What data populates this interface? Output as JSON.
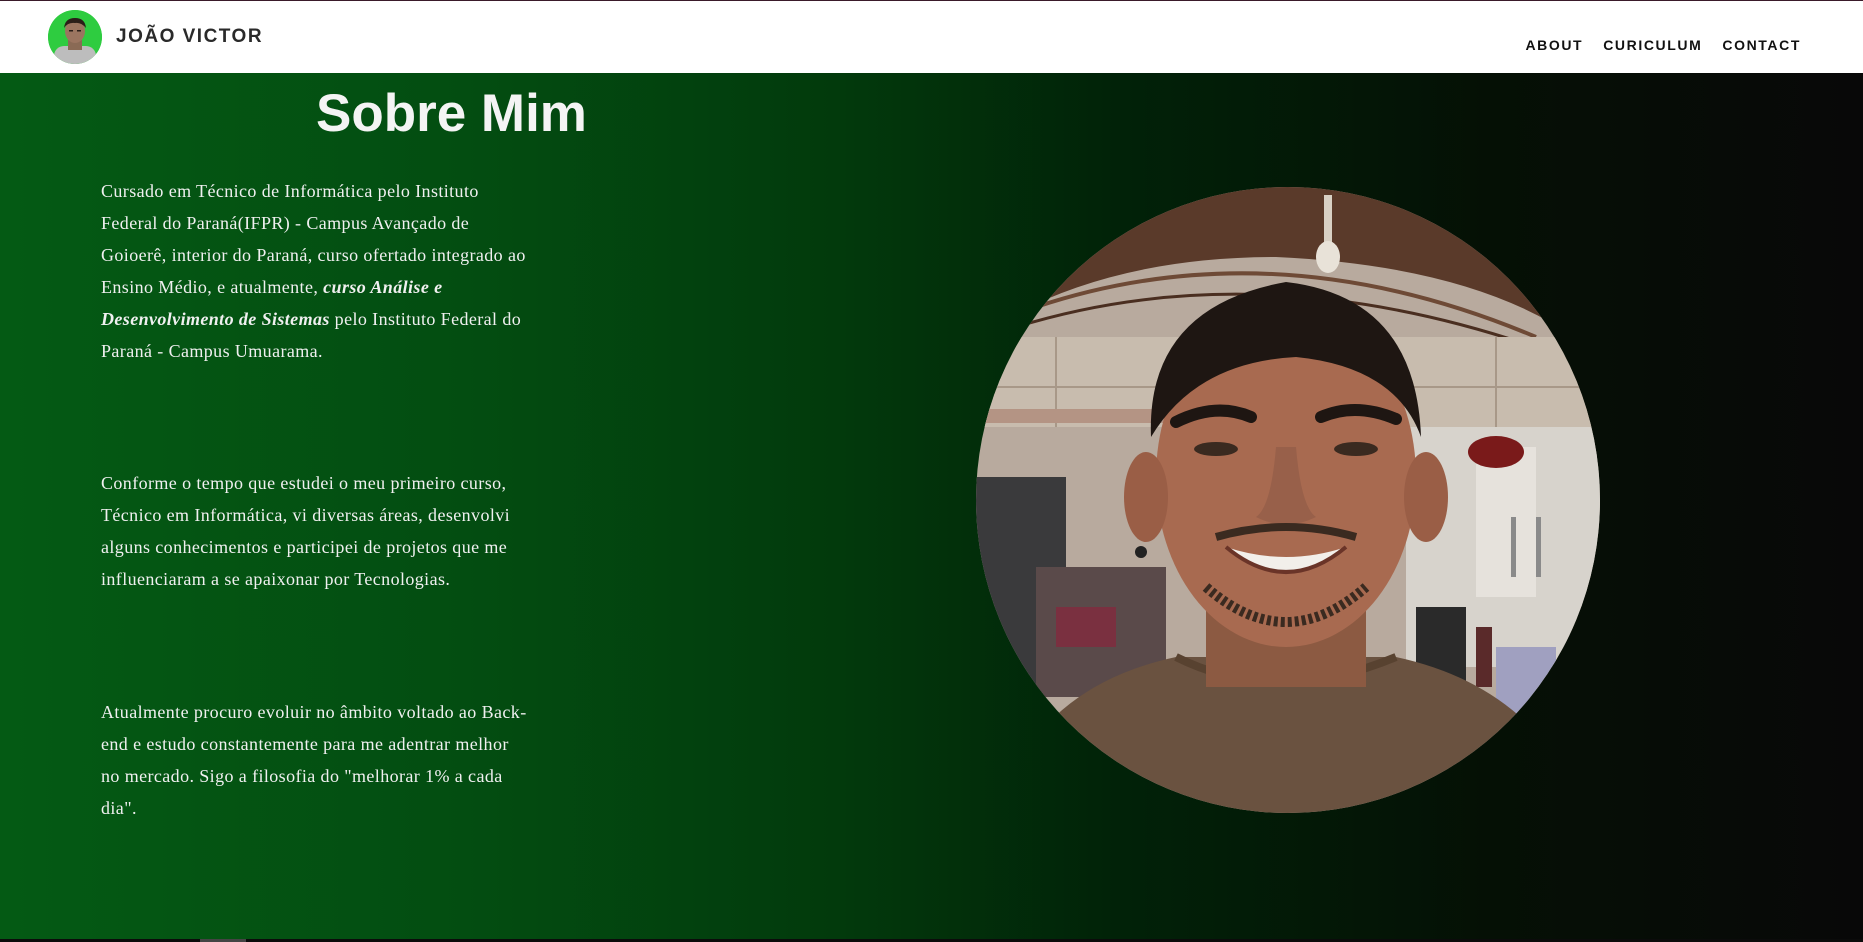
{
  "header": {
    "brand_name": "JOÃO VICTOR",
    "nav": [
      {
        "label": "ABOUT"
      },
      {
        "label": "CURICULUM"
      },
      {
        "label": "CONTACT"
      }
    ]
  },
  "about": {
    "title": "Sobre Mim",
    "p1": {
      "text_before": "Cursado em Técnico de Informática pelo Instituto Federal do Paraná(IFPR) - Campus Avançado de Goioerê, interior do Paraná, curso ofertado integrado ao Ensino Médio, e atualmente, ",
      "emphasis": "curso Análise e Desenvolvimento de Sistemas",
      "text_after": " pelo Instituto Federal do Paraná - Campus Umuarama."
    },
    "p2": "Conforme o tempo que estudei o meu primeiro curso, Técnico em Informática, vi diversas áreas, desenvolvi alguns conhecimentos e participei de projetos que me influenciaram a se apaixonar por Tecnologias.",
    "p3": "Atualmente procuro evoluir no âmbito voltado ao Back-end e estudo constantemente para me adentrar melhor no mercado. Sigo a filosofia do \"melhorar 1% a cada dia\"."
  },
  "colors": {
    "header_bg": "#ffffff",
    "gradient_left": "#045a14",
    "gradient_right": "#080808",
    "avatar_ring": "#2ecc40",
    "text_light": "#f0f0f0"
  }
}
